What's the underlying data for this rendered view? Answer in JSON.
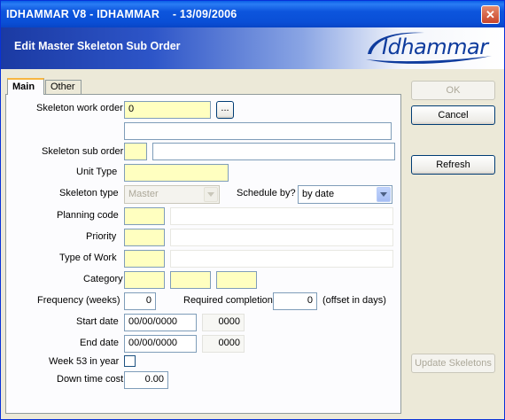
{
  "window": {
    "title": "IDHAMMAR V8 - IDHAMMAR    - 13/09/2006",
    "close_icon": "close-icon"
  },
  "header": {
    "title": "Edit Master Skeleton Sub Order",
    "logo_text": "Idhammar"
  },
  "tabs": [
    {
      "label": "Main",
      "active": true
    },
    {
      "label": "Other",
      "active": false
    }
  ],
  "form": {
    "skeleton_work_order": {
      "label": "Skeleton work order",
      "value": "0",
      "browse_label": "...",
      "description": ""
    },
    "skeleton_sub_order": {
      "label": "Skeleton sub order",
      "value": "",
      "description": ""
    },
    "unit_type": {
      "label": "Unit Type",
      "value": ""
    },
    "skeleton_type": {
      "label": "Skeleton type",
      "value": "Master"
    },
    "schedule_by": {
      "label": "Schedule by?",
      "value": "by date"
    },
    "planning_code": {
      "label": "Planning code",
      "value": "",
      "description": ""
    },
    "priority": {
      "label": "Priority",
      "value": "",
      "description": ""
    },
    "type_of_work": {
      "label": "Type of Work",
      "value": "",
      "description": ""
    },
    "category": {
      "label": "Category",
      "values": [
        "",
        "",
        ""
      ]
    },
    "frequency": {
      "label": "Frequency (weeks)",
      "value": "0"
    },
    "required_completion": {
      "label": "Required completion",
      "value": "0",
      "suffix": "(offset in days)"
    },
    "start_date": {
      "label": "Start date",
      "date": "00/00/0000",
      "time": "0000"
    },
    "end_date": {
      "label": "End date",
      "date": "00/00/0000",
      "time": "0000"
    },
    "week53": {
      "label": "Week 53 in year",
      "checked": false
    },
    "down_time_cost": {
      "label": "Down time cost",
      "value": "0.00"
    }
  },
  "buttons": {
    "ok": "OK",
    "cancel": "Cancel",
    "refresh": "Refresh",
    "update_skeletons": "Update Skeletons"
  }
}
